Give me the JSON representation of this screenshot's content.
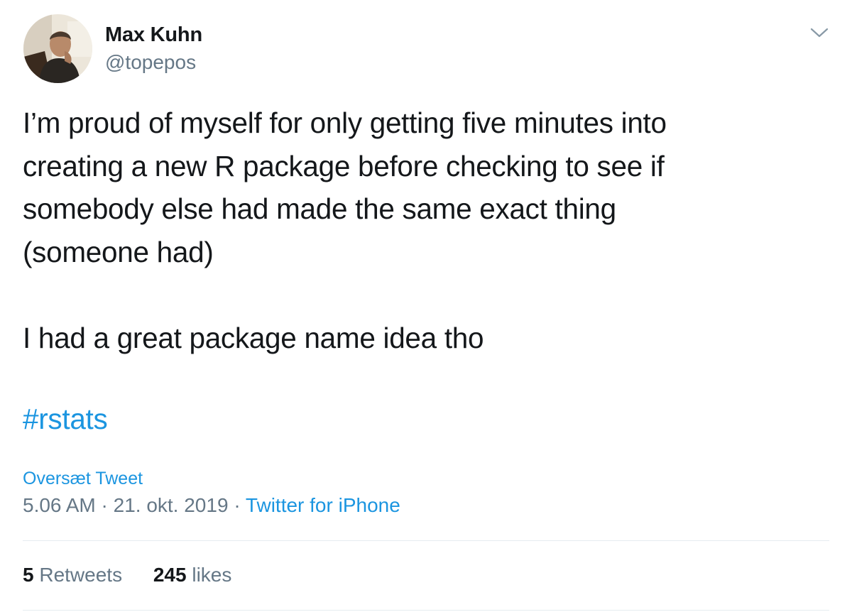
{
  "author": {
    "display_name": "Max Kuhn",
    "handle": "@topepos",
    "avatar_icon": "profile-photo"
  },
  "tweet": {
    "lines": [
      "I’m proud of myself for only getting five minutes into",
      "creating a new R package before checking to see if",
      "somebody else had made the same exact thing",
      "(someone had)",
      "I had a great package name idea tho"
    ],
    "hashtag": "#rstats",
    "translate_label": "Oversæt Tweet",
    "time": "5.06 AM",
    "date": "21. okt. 2019",
    "separator": "·",
    "source": "Twitter for iPhone"
  },
  "stats": {
    "retweets_count": "5",
    "retweets_label": "Retweets",
    "likes_count": "245",
    "likes_label": "likes"
  },
  "menu_icon": "chevron-down-icon",
  "colors": {
    "link": "#1b95e0",
    "secondary": "#657786",
    "primary": "#14171a",
    "divider": "#e6ecf0"
  }
}
